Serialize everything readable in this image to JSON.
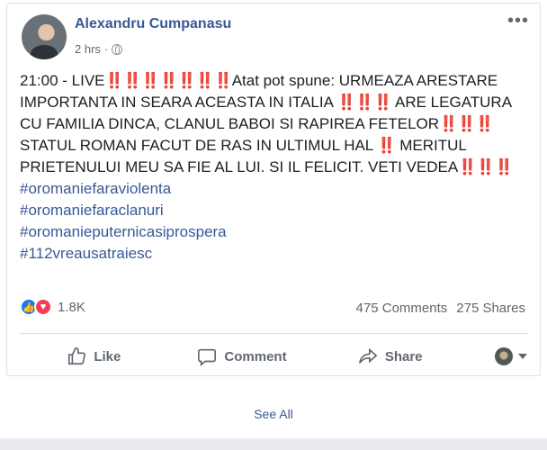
{
  "post": {
    "author": "Alexandru Cumpanasu",
    "time": "2 hrs",
    "dot": "·",
    "more": "•••",
    "segments": [
      {
        "t": "21:00 - LIVE",
        "c": "text"
      },
      {
        "t": "‼️‼️‼️‼️‼️‼️‼️",
        "c": "bang"
      },
      {
        "t": "Atat pot spune: URMEAZA ARESTARE IMPORTANTA IN SEARA ACEASTA IN ITALIA ",
        "c": "text"
      },
      {
        "t": "‼️‼️‼️",
        "c": "bang"
      },
      {
        "t": " ARE LEGATURA CU FAMILIA DINCA, CLANUL BABOI SI RAPIREA FETELOR",
        "c": "text"
      },
      {
        "t": "‼️‼️‼️",
        "c": "bang"
      },
      {
        "t": "STATUL ROMAN FACUT DE RAS IN ULTIMUL HAL ",
        "c": "text"
      },
      {
        "t": "‼️",
        "c": "bang"
      },
      {
        "t": " MERITUL PRIETENULUI MEU SA FIE AL LUI. SI IL FELICIT. VETI VEDEA",
        "c": "text"
      },
      {
        "t": "‼️‼️‼️",
        "c": "bang"
      }
    ],
    "hashtags": [
      "#oromaniefaraviolenta",
      "#oromaniefaraclanuri",
      "#oromanieputernicasiprospera",
      "#112vreausatraiesc"
    ]
  },
  "stats": {
    "reactions": "1.8K",
    "comments": "475 Comments",
    "shares": "275 Shares",
    "icons": [
      "like-icon",
      "love-icon"
    ]
  },
  "actions": {
    "like": "Like",
    "comment": "Comment",
    "share": "Share"
  },
  "footer": {
    "see_all": "See All"
  }
}
